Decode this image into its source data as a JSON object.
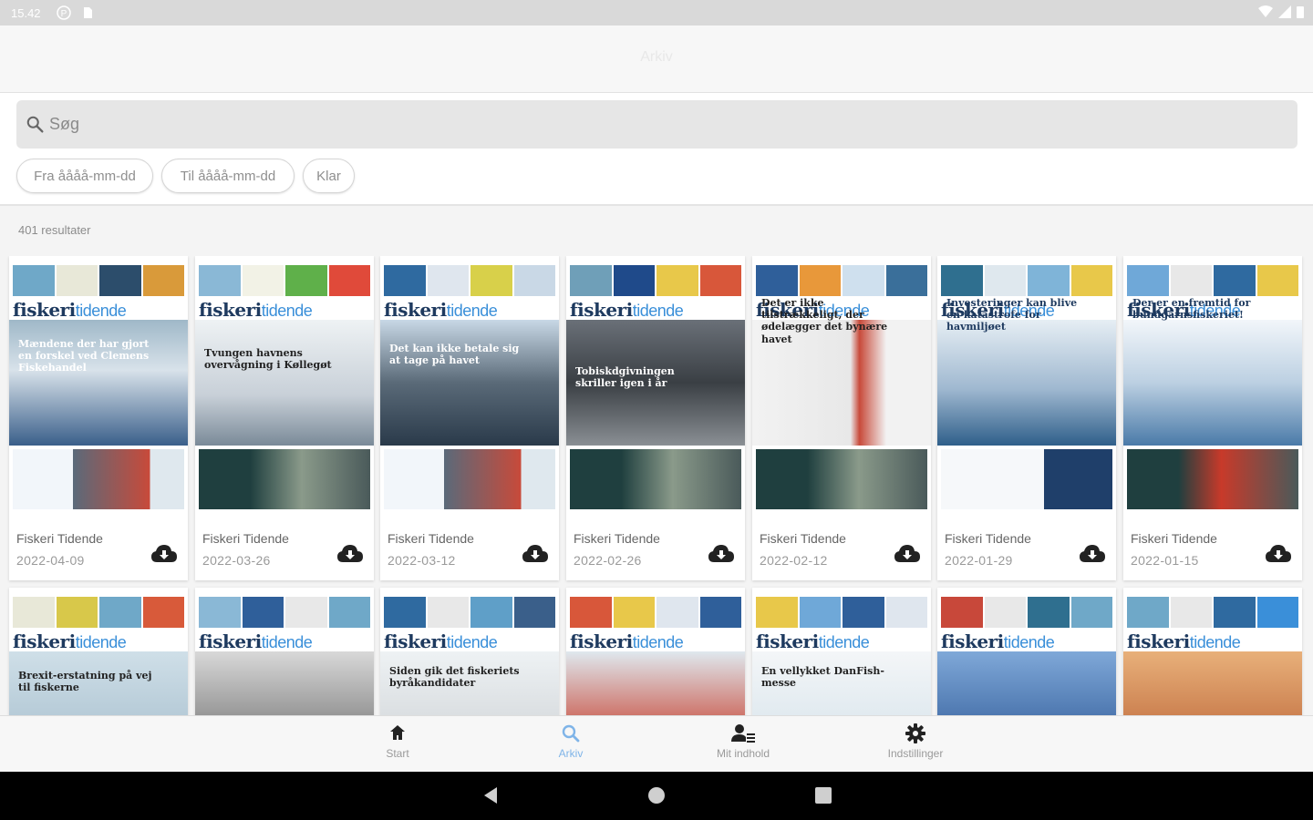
{
  "status_bar": {
    "time": "15.42"
  },
  "app_bar": {
    "title": "Arkiv"
  },
  "search": {
    "placeholder": "Søg",
    "value": ""
  },
  "chips": [
    {
      "label": "Fra åååå-mm-dd"
    },
    {
      "label": "Til åååå-mm-dd"
    },
    {
      "label": "Klar"
    }
  ],
  "results": {
    "count_text": "401 resultater"
  },
  "masthead": {
    "bold": "fiskeri",
    "light": "tidende"
  },
  "issues": [
    {
      "name": "Fiskeri Tidende",
      "date": "2022-04-09",
      "headline": "Mændene der har gjort en forskel ved Clemens Fiskehandel"
    },
    {
      "name": "Fiskeri Tidende",
      "date": "2022-03-26",
      "headline": "Tvungen havnens overvågning i Køllegøt"
    },
    {
      "name": "Fiskeri Tidende",
      "date": "2022-03-12",
      "headline": "Det kan ikke betale sig at tage på havet"
    },
    {
      "name": "Fiskeri Tidende",
      "date": "2022-02-26",
      "headline": "Tobiskdgivningen skriller igen i år"
    },
    {
      "name": "Fiskeri Tidende",
      "date": "2022-02-12",
      "headline": "Det er ikke tilstrækkeligt, der ødelægger det bynære havet"
    },
    {
      "name": "Fiskeri Tidende",
      "date": "2022-01-29",
      "headline": "Investeringer kan blive en katastrofe for havmiljøet"
    },
    {
      "name": "Fiskeri Tidende",
      "date": "2022-01-15",
      "headline": "Der er en fremtid for bundgarnsfiskeriet!"
    },
    {
      "headline": "Brexit-erstatning på vej til fiskerne"
    },
    {
      "headline": ""
    },
    {
      "headline": "Siden gik det fiskeriets byråkandidater"
    },
    {
      "headline": ""
    },
    {
      "headline": "En vellykket DanFish-messe"
    },
    {
      "headline": ""
    },
    {
      "headline": ""
    }
  ],
  "bottom_nav": [
    {
      "label": "Start",
      "icon": "home-icon"
    },
    {
      "label": "Arkiv",
      "icon": "search-icon",
      "active": true
    },
    {
      "label": "Mit indhold",
      "icon": "person-list-icon"
    },
    {
      "label": "Indstillinger",
      "icon": "gear-icon"
    }
  ],
  "colors": {
    "accent": "#7fb4e8",
    "masthead_dark": "#1e3a5f",
    "masthead_light": "#3a8fd9"
  }
}
